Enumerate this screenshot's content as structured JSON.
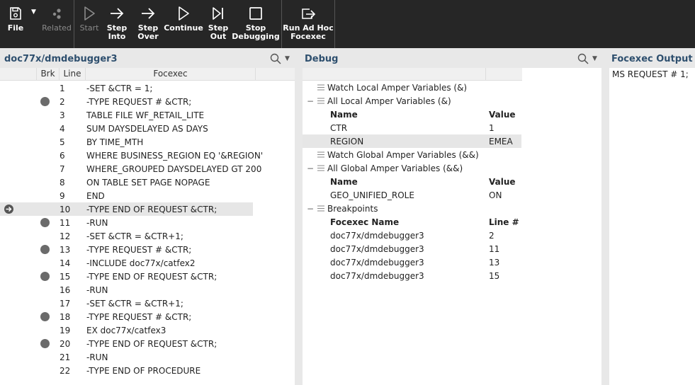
{
  "toolbar": {
    "file": "File",
    "related": "Related",
    "start": "Start",
    "step_into": "Step\nInto",
    "step_over": "Step\nOver",
    "continue": "Continue",
    "step_out": "Step\nOut",
    "stop_debugging": "Stop\nDebugging",
    "run_ad_hoc": "Run Ad Hoc\nFocexec"
  },
  "editor": {
    "title": "doc77x/dmdebugger3",
    "columns": {
      "brk": "Brk",
      "line": "Line",
      "focexec": "Focexec"
    },
    "rows": [
      {
        "line": "1",
        "text": "-SET &CTR = 1;",
        "bp": false
      },
      {
        "line": "2",
        "text": "-TYPE REQUEST # &CTR;",
        "bp": true
      },
      {
        "line": "3",
        "text": "TABLE FILE WF_RETAIL_LITE",
        "bp": false
      },
      {
        "line": "4",
        "text": "SUM DAYSDELAYED AS DAYS",
        "bp": false
      },
      {
        "line": "5",
        "text": "BY TIME_MTH",
        "bp": false
      },
      {
        "line": "6",
        "text": "WHERE BUSINESS_REGION EQ '&REGION'",
        "bp": false
      },
      {
        "line": "7",
        "text": "WHERE_GROUPED DAYSDELAYED GT 200",
        "bp": false
      },
      {
        "line": "8",
        "text": "ON TABLE SET PAGE NOPAGE",
        "bp": false
      },
      {
        "line": "9",
        "text": "END",
        "bp": false
      },
      {
        "line": "10",
        "text": "-TYPE END OF REQUEST &CTR;",
        "bp": false,
        "current": true
      },
      {
        "line": "11",
        "text": "-RUN",
        "bp": true
      },
      {
        "line": "12",
        "text": "-SET &CTR = &CTR+1;",
        "bp": false
      },
      {
        "line": "13",
        "text": "-TYPE REQUEST # &CTR;",
        "bp": true
      },
      {
        "line": "14",
        "text": "-INCLUDE doc77x/catfex2",
        "bp": false
      },
      {
        "line": "15",
        "text": "-TYPE END OF REQUEST &CTR;",
        "bp": true
      },
      {
        "line": "16",
        "text": "-RUN",
        "bp": false
      },
      {
        "line": "17",
        "text": "-SET &CTR = &CTR+1;",
        "bp": false
      },
      {
        "line": "18",
        "text": "-TYPE REQUEST # &CTR;",
        "bp": true
      },
      {
        "line": "19",
        "text": "EX doc77x/catfex3",
        "bp": false
      },
      {
        "line": "20",
        "text": "-TYPE END OF REQUEST &CTR;",
        "bp": true
      },
      {
        "line": "21",
        "text": "-RUN",
        "bp": false
      },
      {
        "line": "22",
        "text": "-TYPE END OF PROCEDURE",
        "bp": false
      }
    ]
  },
  "debug": {
    "title": "Debug",
    "rows": [
      {
        "kind": "node",
        "expanded": false,
        "label": "Watch Local Amper Variables (&)"
      },
      {
        "kind": "node",
        "expanded": true,
        "label": "All Local Amper Variables (&)"
      },
      {
        "kind": "head",
        "c1": "Name",
        "c2": "Value"
      },
      {
        "kind": "item",
        "c1": "CTR",
        "c2": "1"
      },
      {
        "kind": "item",
        "c1": "REGION",
        "c2": "EMEA",
        "selected": true
      },
      {
        "kind": "node",
        "expanded": false,
        "label": "Watch Global Amper Variables (&&)"
      },
      {
        "kind": "node",
        "expanded": true,
        "label": "All Global Amper Variables (&&)"
      },
      {
        "kind": "head",
        "c1": "Name",
        "c2": "Value"
      },
      {
        "kind": "item",
        "c1": "GEO_UNIFIED_ROLE",
        "c2": "ON"
      },
      {
        "kind": "node",
        "expanded": true,
        "label": "Breakpoints"
      },
      {
        "kind": "head",
        "c1": "Focexec Name",
        "c2": "Line #"
      },
      {
        "kind": "item",
        "c1": "doc77x/dmdebugger3",
        "c2": "2"
      },
      {
        "kind": "item",
        "c1": "doc77x/dmdebugger3",
        "c2": "11"
      },
      {
        "kind": "item",
        "c1": "doc77x/dmdebugger3",
        "c2": "13"
      },
      {
        "kind": "item",
        "c1": "doc77x/dmdebugger3",
        "c2": "15"
      }
    ]
  },
  "output": {
    "title": "Focexec Output",
    "text": "MS REQUEST # 1;"
  },
  "icons": {
    "save": "save-icon",
    "related": "related-icon",
    "start": "play-outline-icon",
    "step_into": "arrow-right-icon",
    "step_over": "arrow-right-icon",
    "continue": "play-outline-icon",
    "step_out": "step-out-icon",
    "stop": "stop-square-icon",
    "run_ad_hoc": "run-export-icon",
    "search": "search-icon",
    "current_line": "current-line-arrow-icon",
    "breakpoint": "breakpoint-icon",
    "tree_node": "tree-node-icon"
  }
}
